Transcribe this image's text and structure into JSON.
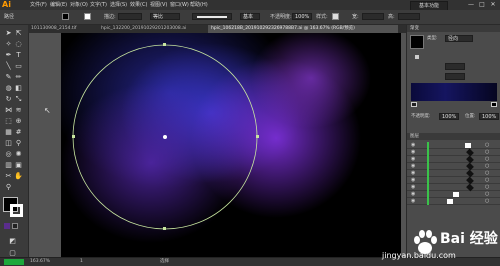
{
  "app": {
    "logo": "Ai"
  },
  "menubar": {
    "items": [
      "文件(F)",
      "编辑(E)",
      "对象(O)",
      "文字(T)",
      "选择(S)",
      "效果(C)",
      "视图(V)",
      "窗口(W)",
      "帮助(H)"
    ],
    "workspace": "基本功能",
    "window_controls": [
      "—",
      "□",
      "✕"
    ]
  },
  "controlbar": {
    "mode_label": "路径",
    "stroke_label": "描边:",
    "stroke_value": "",
    "profile": "等比",
    "brush": "基本",
    "opacity_label": "不透明度:",
    "opacity_value": "100%",
    "style_label": "样式:",
    "w_label": "宽:",
    "h_label": "高:"
  },
  "tabs": [
    {
      "label": "101130908_2154.tif",
      "active": false
    },
    {
      "label": "hpic_132200_20191029201203008.ai",
      "active": false
    },
    {
      "label": "hpic_106218B_2019102923269788B7.ai @ 163.67% (RGB/预览)",
      "active": true
    }
  ],
  "right_panel": {
    "gradient_tab": "渐变",
    "type_label": "类型:",
    "type_value": "径向",
    "opacity_label": "不透明度:",
    "opacity_value": "100%",
    "location_label": "位置:",
    "location_value": "100%",
    "layers_tab": "图层",
    "layer_count": 9
  },
  "statusbar": {
    "zoom": "163.67%",
    "artboard": "1",
    "tool": "选择"
  },
  "watermark": {
    "text": "Bai 经验",
    "url": "jingyan.baidu.com"
  },
  "colors": {
    "accent": "#ff9a00",
    "canvas_bg": "#000000",
    "selection_circle": "#c8e6a0"
  }
}
